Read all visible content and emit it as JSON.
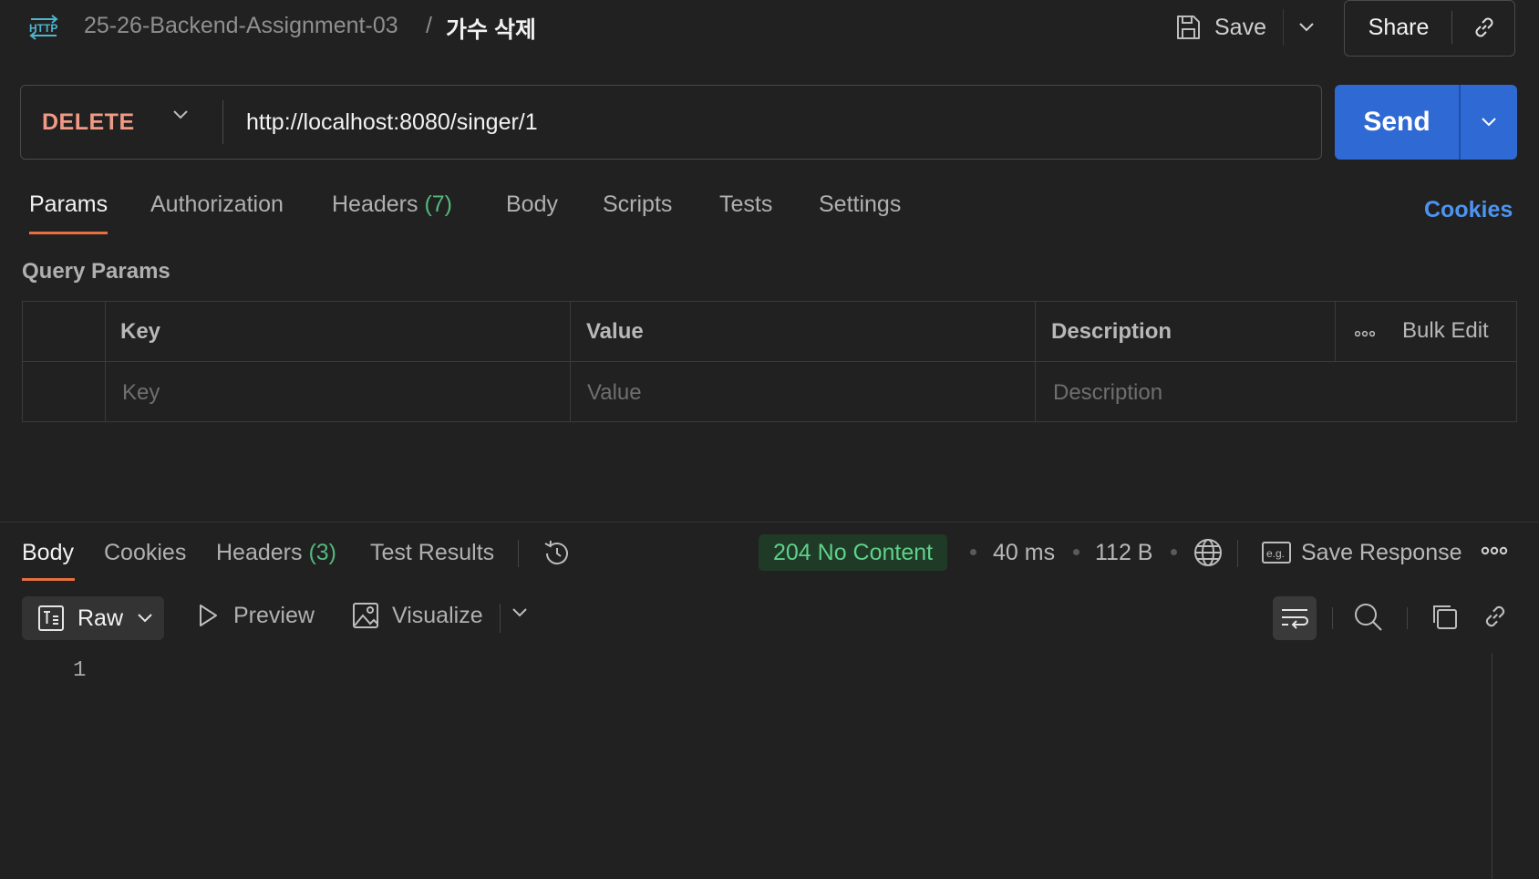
{
  "header": {
    "collection": "25-26-Backend-Assignment-03",
    "separator": "/",
    "request_name": "가수 삭제",
    "save_label": "Save",
    "share_label": "Share"
  },
  "request": {
    "method": "DELETE",
    "url": "http://localhost:8080/singer/1",
    "send_label": "Send"
  },
  "request_tabs": {
    "params": "Params",
    "authorization": "Authorization",
    "headers": "Headers",
    "headers_count": "(7)",
    "body": "Body",
    "scripts": "Scripts",
    "tests": "Tests",
    "settings": "Settings",
    "active": "Params",
    "cookies_link": "Cookies"
  },
  "query_params": {
    "title": "Query Params",
    "columns": [
      "Key",
      "Value",
      "Description"
    ],
    "placeholders": {
      "key": "Key",
      "value": "Value",
      "description": "Description"
    },
    "bulk_edit": "Bulk Edit"
  },
  "response": {
    "tabs": {
      "body": "Body",
      "cookies": "Cookies",
      "headers": "Headers",
      "headers_count": "(3)",
      "test_results": "Test Results",
      "active": "Body"
    },
    "status": "204 No Content",
    "time": "40 ms",
    "size": "112 B",
    "save_response": "Save Response",
    "format": "Raw",
    "preview": "Preview",
    "visualize": "Visualize",
    "line_numbers": [
      "1"
    ]
  },
  "colors": {
    "background": "#212121",
    "accent_orange": "#e8703f",
    "send_blue": "#2f69d4",
    "method_delete": "#f09a85",
    "status_green": "#5fd18a",
    "link_blue": "#4d94f0"
  },
  "icons": [
    "http-icon",
    "save-icon",
    "chevron-down-icon",
    "link-icon",
    "more-dots-icon",
    "history-icon",
    "globe-icon",
    "eg-icon",
    "raw-format-icon",
    "play-icon",
    "image-icon",
    "wrap-lines-icon",
    "search-icon",
    "copy-icon"
  ]
}
